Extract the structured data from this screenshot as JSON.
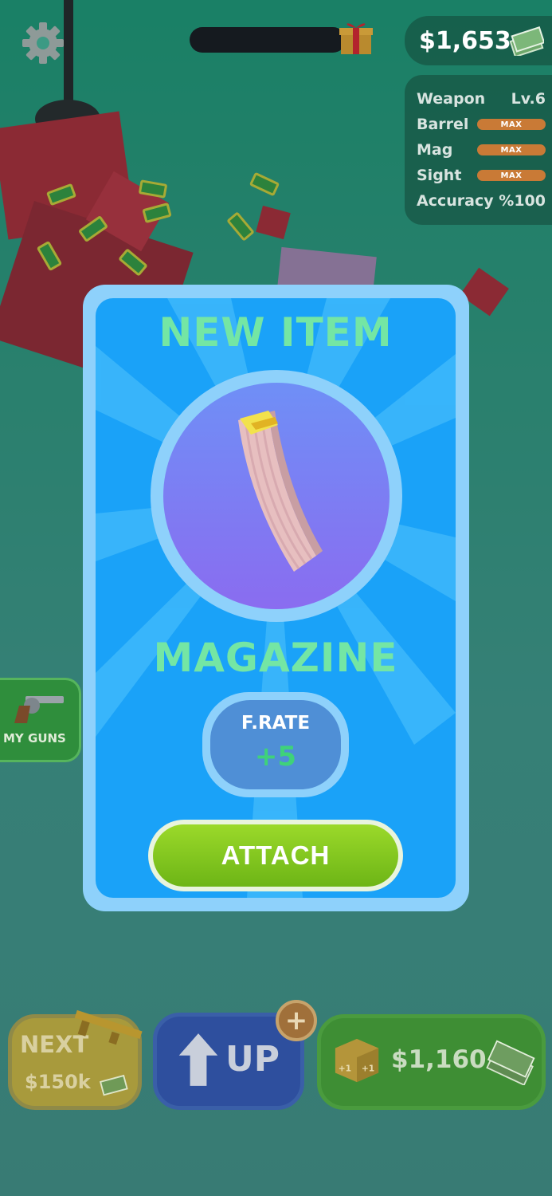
{
  "hud": {
    "money": "$1,653",
    "stats": [
      {
        "label": "Weapon",
        "value": "Lv.6"
      },
      {
        "label": "Barrel",
        "value": "MAX"
      },
      {
        "label": "Mag",
        "value": "MAX"
      },
      {
        "label": "Sight",
        "value": "MAX"
      },
      {
        "label": "Accuracy",
        "value": "%100"
      }
    ]
  },
  "side": {
    "my_guns_label": "MY GUNS"
  },
  "popup": {
    "title": "NEW ITEM",
    "item_name": "MAGAZINE",
    "stat_label": "F.RATE",
    "stat_value": "+5",
    "attach_label": "ATTACH"
  },
  "bottom": {
    "next_label": "NEXT",
    "next_price": "$150k",
    "up_label": "UP",
    "buy_price": "$1,160",
    "crate_badge": "+1"
  },
  "colors": {
    "title_green": "#74e6a4",
    "card_blue": "#1aa2f8",
    "attach_green": "#7cc21c",
    "stat_green": "#3fd27a"
  },
  "icons": [
    "gear-icon",
    "gift-icon",
    "cash-icon",
    "revolver-icon",
    "rifle-icon",
    "arrow-up-icon",
    "plus-icon",
    "crate-icon",
    "magazine-icon"
  ]
}
